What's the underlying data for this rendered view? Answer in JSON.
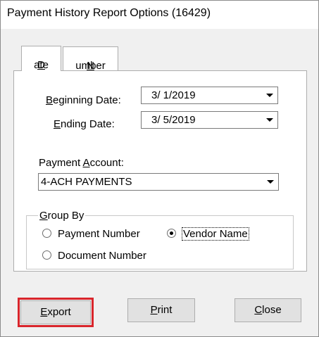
{
  "window": {
    "title": "Payment History Report Options (16429)"
  },
  "tabs": [
    {
      "key": "D",
      "rest": "ate"
    },
    {
      "key": "N",
      "rest": "umber"
    }
  ],
  "date_fields": {
    "beginning": {
      "label_pre": "",
      "key": "B",
      "label_post": "eginning Date:",
      "value": "3/  1/2019"
    },
    "ending": {
      "label_pre": "",
      "key": "E",
      "label_post": "nding Date:",
      "value": "3/  5/2019"
    }
  },
  "payment_account": {
    "label_pre": "Payment ",
    "key": "A",
    "label_post": "ccount:",
    "value": "4-ACH PAYMENTS"
  },
  "group_by": {
    "legend_key": "G",
    "legend_rest": "roup By",
    "options": [
      {
        "label": "Payment Number",
        "selected": false
      },
      {
        "label": "Vendor Name",
        "selected": true
      },
      {
        "label": "Document Number",
        "selected": false
      }
    ]
  },
  "buttons": {
    "export": {
      "key": "E",
      "rest": "xport"
    },
    "print": {
      "key": "P",
      "rest": "rint"
    },
    "close": {
      "key": "C",
      "rest": "lose"
    }
  },
  "colors": {
    "highlight": "#d9262c",
    "background": "#f0f0f0"
  }
}
